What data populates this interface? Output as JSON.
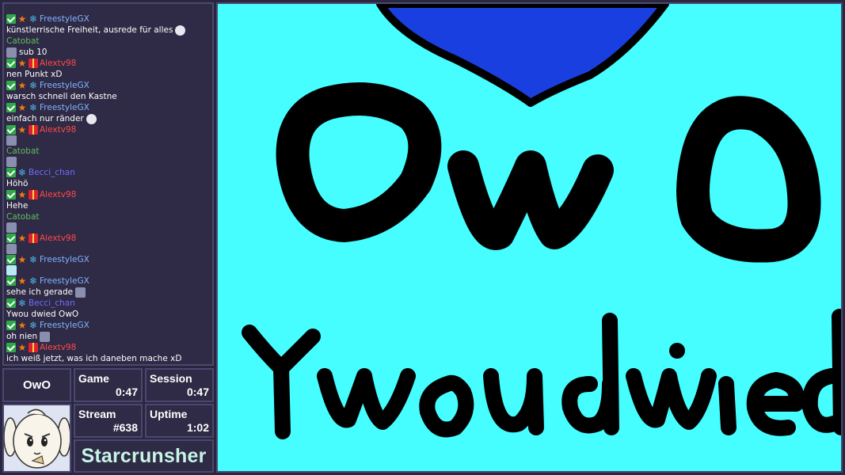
{
  "chat": {
    "messages": [
      {
        "user": "FreestyleGX",
        "color": "#7fb5ff",
        "badges": [
          "check",
          "star",
          "snow"
        ],
        "text": "künstlerrische Freiheit, ausrede für alles",
        "emote": "mask"
      },
      {
        "user": "Catobat",
        "color": "#5fbf5f",
        "badges": [],
        "text": "sub 10",
        "emote_first": "cat"
      },
      {
        "user": "Alextv98",
        "color": "#ff4a4a",
        "badges": [
          "check",
          "star",
          "gift"
        ],
        "text": "nen Punkt xD"
      },
      {
        "user": "FreestyleGX",
        "color": "#7fb5ff",
        "badges": [
          "check",
          "star",
          "snow"
        ],
        "text": "warsch schnell den Kastne"
      },
      {
        "user": "FreestyleGX",
        "color": "#7fb5ff",
        "badges": [
          "check",
          "star",
          "snow"
        ],
        "text": "einfach nur ränder",
        "emote": "mask"
      },
      {
        "user": "Alextv98",
        "color": "#ff4a4a",
        "badges": [
          "check",
          "star",
          "gift"
        ],
        "text": "",
        "emote_only": "cat"
      },
      {
        "user": "Catobat",
        "color": "#5fbf5f",
        "badges": [],
        "text": "",
        "emote_only": "cat"
      },
      {
        "user": "Becci_chan",
        "color": "#6f6fff",
        "badges": [
          "check",
          "snow"
        ],
        "text": "Höhö"
      },
      {
        "user": "Alextv98",
        "color": "#ff4a4a",
        "badges": [
          "check",
          "star",
          "gift"
        ],
        "text": "Hehe"
      },
      {
        "user": "Catobat",
        "color": "#5fbf5f",
        "badges": [],
        "text": "",
        "emote_only": "cat"
      },
      {
        "user": "Alextv98",
        "color": "#ff4a4a",
        "badges": [
          "check",
          "star",
          "gift"
        ],
        "text": "",
        "emote_only": "cat"
      },
      {
        "user": "FreestyleGX",
        "color": "#7fb5ff",
        "badges": [
          "check",
          "star",
          "snow"
        ],
        "text": "",
        "emote_only": "owo"
      },
      {
        "user": "FreestyleGX",
        "color": "#7fb5ff",
        "badges": [
          "check",
          "star",
          "snow"
        ],
        "text": "sehe ich gerade",
        "emote": "cat"
      },
      {
        "user": "Becci_chan",
        "color": "#6f6fff",
        "badges": [
          "check",
          "snow"
        ],
        "text": "Ywou dwied OwO"
      },
      {
        "user": "FreestyleGX",
        "color": "#7fb5ff",
        "badges": [
          "check",
          "star",
          "snow"
        ],
        "text": "oh nien",
        "emote": "cat"
      },
      {
        "user": "Alextv98",
        "color": "#ff4a4a",
        "badges": [
          "check",
          "star",
          "gift"
        ],
        "text": "ich weiß jetzt, was ich daneben mache xD"
      }
    ]
  },
  "stats": {
    "owo_label": "OwO",
    "game_label": "Game",
    "game_value": "0:47",
    "session_label": "Session",
    "session_value": "0:47",
    "stream_label": "Stream",
    "stream_value": "#638",
    "uptime_label": "Uptime",
    "uptime_value": "1:02",
    "streamer_name": "Starcrunsher"
  },
  "colors": {
    "canvas_bg": "#46feff",
    "ink": "#000000",
    "blob": "#1a3fe0",
    "panel_bg": "#2f2a45",
    "panel_border": "#4b4870",
    "name_color": "#c7f5e6"
  },
  "icons": {
    "check": "check-badge-icon",
    "star": "star-badge-icon",
    "snow": "snowflake-badge-icon",
    "gift": "gift-badge-icon"
  }
}
